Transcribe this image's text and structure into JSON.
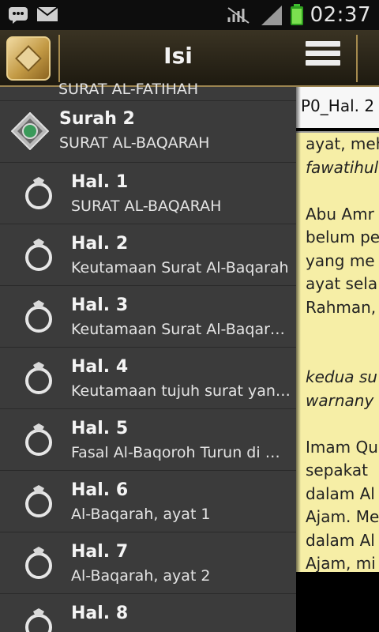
{
  "status_bar": {
    "time": "02:37",
    "icons": [
      "bbm-icon",
      "mail-icon",
      "no-signal-icon",
      "signal-icon",
      "battery-icon"
    ]
  },
  "drawer": {
    "title": "Isi",
    "partial_top_item": "SURAT AL-FATIHAH",
    "surah_item": {
      "title": "Surah 2",
      "subtitle": "SURAT AL-BAQARAH"
    },
    "pages": [
      {
        "title": "Hal. 1",
        "subtitle": "SURAT AL-BAQARAH"
      },
      {
        "title": "Hal. 2",
        "subtitle": "Keutamaan Surat Al-Baqarah"
      },
      {
        "title": "Hal. 3",
        "subtitle": "Keutamaan Surat Al-Baqara..."
      },
      {
        "title": "Hal. 4",
        "subtitle": "Keutamaan tujuh surat yang..."
      },
      {
        "title": "Hal. 5",
        "subtitle": "Fasal Al-Baqoroh Turun di M..."
      },
      {
        "title": "Hal. 6",
        "subtitle": "Al-Baqarah, ayat 1"
      },
      {
        "title": "Hal. 7",
        "subtitle": "Al-Baqarah, ayat 2"
      },
      {
        "title": "Hal. 8",
        "subtitle": ""
      }
    ]
  },
  "content": {
    "tab_label": "P0_Hal. 2",
    "lines": [
      {
        "text": "ayat, meh",
        "italic": false
      },
      {
        "text": "fawatihul",
        "italic": true
      },
      {
        "text": "",
        "italic": false
      },
      {
        "text": "Abu Amr",
        "italic": false
      },
      {
        "text": "belum pe",
        "italic": false
      },
      {
        "text": "yang me",
        "italic": false
      },
      {
        "text": "ayat sela",
        "italic": false
      },
      {
        "text": "Rahman,",
        "italic": false
      },
      {
        "text": "",
        "italic": false
      },
      {
        "text": "",
        "italic": false
      },
      {
        "text": "kedua su",
        "italic": true
      },
      {
        "text": "warnany",
        "italic": true
      },
      {
        "text": "",
        "italic": false
      },
      {
        "text": "Imam Qu",
        "italic": false
      },
      {
        "text": "sepakat",
        "italic": false
      },
      {
        "text": "dalam Al",
        "italic": false
      },
      {
        "text": "Ajam. Me",
        "italic": false
      },
      {
        "text": "dalam Al",
        "italic": false
      },
      {
        "text": "Ajam, mi",
        "italic": false
      }
    ]
  },
  "colors": {
    "drawer_bg": "#3b3b3b",
    "header_gold": "#9b8450",
    "content_bg": "#f6eea6"
  }
}
